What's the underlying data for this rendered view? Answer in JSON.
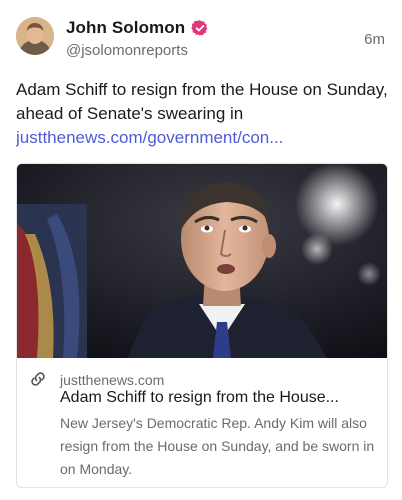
{
  "post": {
    "author": {
      "display_name": "John Solomon",
      "handle": "@jsolomonreports",
      "verified": true,
      "verified_color": "#e0367a",
      "avatar": "user-avatar"
    },
    "timestamp": "6m",
    "text": "Adam Schiff to resign from the House on Sunday, ahead of Senate's swearing in",
    "link_text": "justthenews.com/government/con...",
    "link_color": "#4f5bd5"
  },
  "link_card": {
    "image": "news-photo",
    "icon": "link-icon",
    "domain": "justthenews.com",
    "title": "Adam Schiff to resign from the House...",
    "description": "New Jersey's Democratic Rep. Andy Kim will also resign from the House on Sunday, and be sworn in on Monday."
  }
}
